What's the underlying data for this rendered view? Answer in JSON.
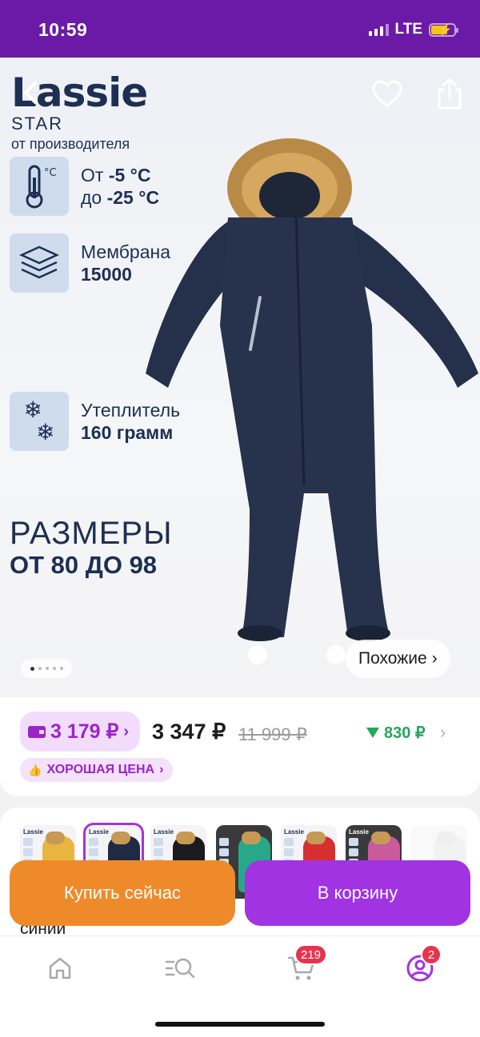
{
  "status_bar": {
    "time": "10:59",
    "network": "LTE"
  },
  "hero": {
    "brand": "Lassie",
    "brand_line": "STAR",
    "brand_sub": "от производителя",
    "features": [
      {
        "icon": "thermometer-icon",
        "line1_pre": "От ",
        "line1_val": "-5 °C",
        "line2_pre": "до ",
        "line2_val": "-25 °C"
      },
      {
        "icon": "membrane-layers-icon",
        "line1": "Мембрана",
        "line2": "15000"
      },
      {
        "icon": "snowflake-icon",
        "line1": "Утеплитель",
        "line2": "160 грамм"
      }
    ],
    "sizes_line1": "РАЗМЕРЫ",
    "sizes_line2": "ОТ 80 ДО 98",
    "similar_label": "Похожие",
    "slide_count": 5,
    "active_slide": 1
  },
  "price": {
    "wallet_price": "3 179 ₽",
    "main_price": "3 347 ₽",
    "old_price": "11 999 ₽",
    "discount": "830 ₽",
    "good_price_label": "ХОРОШАЯ ЦЕНА"
  },
  "variants": {
    "selected_color": "синий",
    "items": [
      {
        "color": "#e8b640",
        "selected": false
      },
      {
        "color": "#1f2a44",
        "selected": true
      },
      {
        "color": "#1b1b1f",
        "selected": false
      },
      {
        "color": "#27a88a",
        "selected": false
      },
      {
        "color": "#d62f2f",
        "selected": false
      },
      {
        "color": "#c95a9c",
        "selected": false
      },
      {
        "color": "#e6e6e8",
        "selected": false
      }
    ]
  },
  "actions": {
    "buy_now": "Купить сейчас",
    "add_to_cart": "В корзину"
  },
  "nav": {
    "cart_badge": "219",
    "profile_badge": "2"
  },
  "colors": {
    "accent": "#a133e3",
    "status_bar": "#6b1aa8",
    "buy": "#ef8a2a",
    "navy": "#1d2f52"
  }
}
